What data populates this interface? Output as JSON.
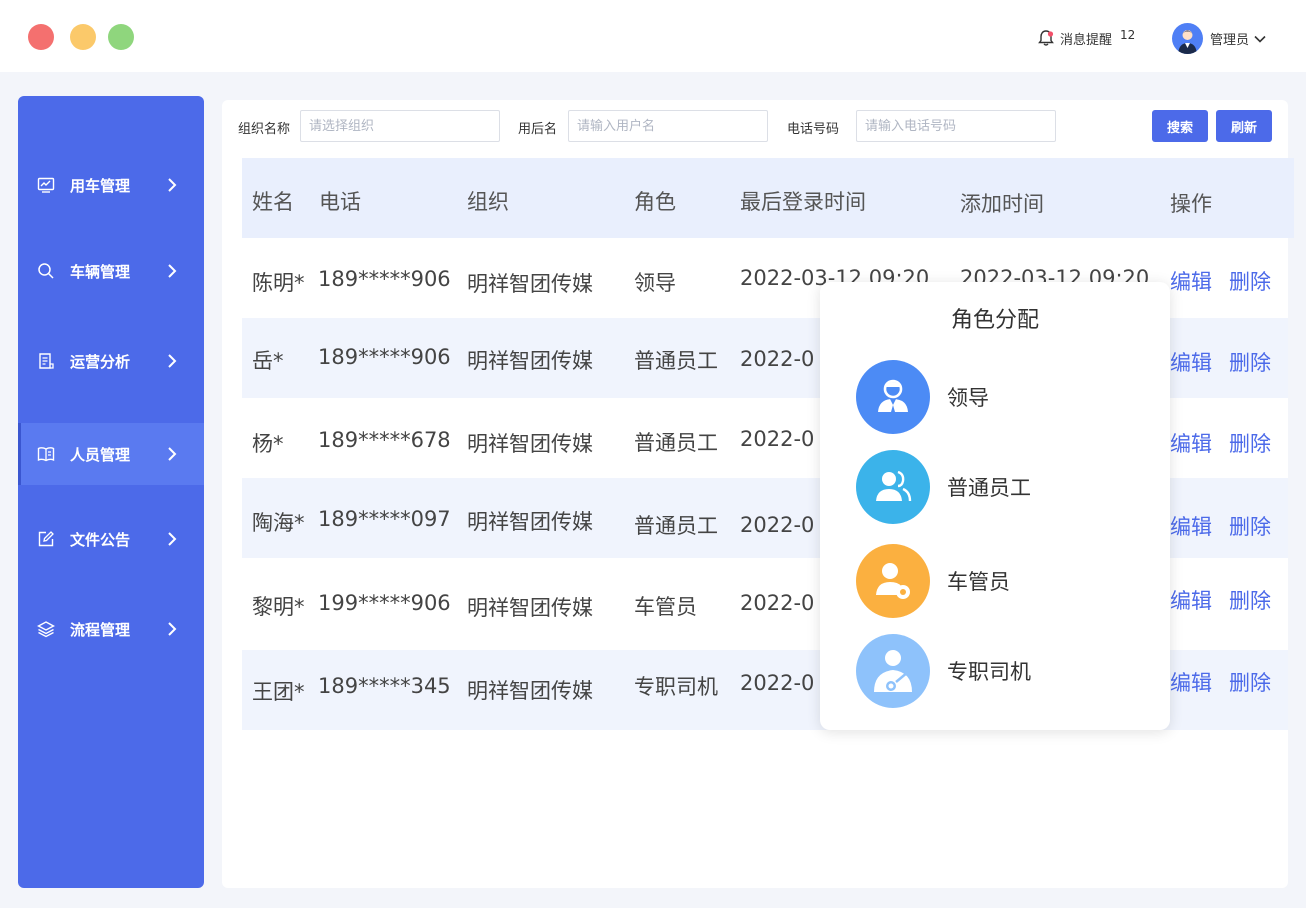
{
  "header": {
    "notification_label": "消息提醒",
    "notification_count": "12",
    "user_name": "管理员"
  },
  "sidebar": {
    "items": [
      {
        "label": "用车管理",
        "icon": "chart-board-icon"
      },
      {
        "label": "车辆管理",
        "icon": "search-icon"
      },
      {
        "label": "运营分析",
        "icon": "report-icon"
      },
      {
        "label": "人员管理",
        "icon": "book-icon",
        "active": true
      },
      {
        "label": "文件公告",
        "icon": "edit-icon"
      },
      {
        "label": "流程管理",
        "icon": "layers-icon"
      }
    ]
  },
  "filters": {
    "org_label": "组织名称",
    "org_placeholder": "请选择组织",
    "user_label": "用后名",
    "user_placeholder": "请输入用户名",
    "phone_label": "电话号码",
    "phone_placeholder": "请输入电话号码",
    "search_button": "搜索",
    "refresh_button": "刷新"
  },
  "table": {
    "headers": [
      "姓名",
      "电话",
      "组织",
      "角色",
      "最后登录时间",
      "添加时间",
      "操作"
    ],
    "rows": [
      {
        "name": "陈明*",
        "phone": "189*****906",
        "org": "明祥智团传媒",
        "role": "领导",
        "last_login": "2022-03-12 09:20",
        "added": "2022-03-12 09:20"
      },
      {
        "name": "岳*",
        "phone": "189*****906",
        "org": "明祥智团传媒",
        "role": "普通员工",
        "last_login": "2022-0"
      },
      {
        "name": "杨*",
        "phone": "189*****678",
        "org": "明祥智团传媒",
        "role": "普通员工",
        "last_login": "2022-0"
      },
      {
        "name": "陶海*",
        "phone": "189*****097",
        "org": "明祥智团传媒",
        "role": "普通员工",
        "last_login": "2022-0"
      },
      {
        "name": "黎明*",
        "phone": "199*****906",
        "org": "明祥智团传媒",
        "role": "车管员",
        "last_login": "2022-0"
      },
      {
        "name": "王团*",
        "phone": "189*****345",
        "org": "明祥智团传媒",
        "role": "专职司机",
        "last_login": "2022-0"
      }
    ],
    "edit_label": "编辑",
    "delete_label": "删除"
  },
  "popup": {
    "title": "角色分配",
    "roles": [
      {
        "label": "领导",
        "color": "#4c8bf5"
      },
      {
        "label": "普通员工",
        "color": "#3bb3ea"
      },
      {
        "label": "车管员",
        "color": "#fbb040"
      },
      {
        "label": "专职司机",
        "color": "#8ec2fb"
      }
    ]
  }
}
